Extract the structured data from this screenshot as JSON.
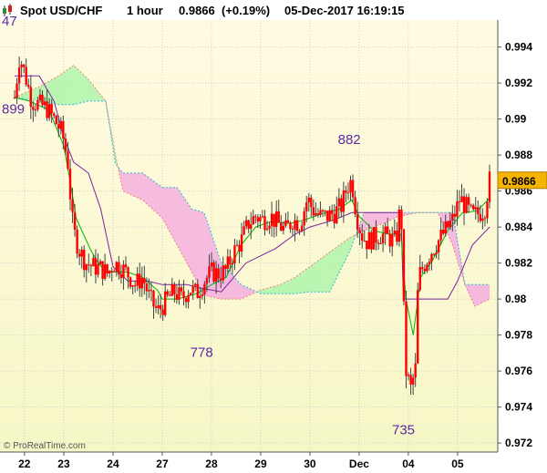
{
  "header": {
    "title": "Spot USD/CHF",
    "timeframe": "1 hour",
    "last_price": "0.9866",
    "change": "(+0.19%)",
    "timestamp": "05-Dec-2017 16:19:15",
    "icon": "candlestick-icon"
  },
  "credit": "© ProRealTime.com",
  "colors": {
    "background_top": "#fffbe2",
    "background_bottom": "#f6f7c6",
    "candle_body": "#ff0000",
    "candle_wick": "#444444",
    "tenkan": "#00b400",
    "kijun": "#7b1fa2",
    "chikou_cloud_bullish": "#b8f5b0",
    "cloud_bearish": "#f6b8de",
    "span_a": "#f08080",
    "span_b": "#2ab7d8",
    "price_tag": "#f4b400",
    "annotation": "#5b2aa0",
    "grid": "#cfcfcf"
  },
  "chart_data": {
    "type": "candlestick",
    "instrument": "Spot USD/CHF",
    "interval": "1 hour",
    "ylim": [
      0.9715,
      0.9955
    ],
    "y_ticks": [
      "0.972",
      "0.974",
      "0.976",
      "0.978",
      "0.98",
      "0.982",
      "0.984",
      "0.986",
      "0.988",
      "0.99",
      "0.992",
      "0.994"
    ],
    "y_tick_values": [
      0.972,
      0.974,
      0.976,
      0.978,
      0.98,
      0.982,
      0.984,
      0.986,
      0.988,
      0.99,
      0.992,
      0.994
    ],
    "x_ticks": [
      "22",
      "23",
      "24",
      "27",
      "28",
      "29",
      "30",
      "Dec",
      "04",
      "05"
    ],
    "x_tick_sessions": [
      0.2,
      1.0,
      2.0,
      3.0,
      4.0,
      5.0,
      6.0,
      7.0,
      8.0,
      9.0
    ],
    "sessions_span": [
      0,
      9.65
    ],
    "current_price": "0.9866",
    "annotations": [
      {
        "text": "47",
        "x": 0.0,
        "y": 0.9948
      },
      {
        "text": "899",
        "x": 0.0,
        "y": 0.9899
      },
      {
        "text": "882",
        "x": 6.8,
        "y": 0.9882
      },
      {
        "text": "778",
        "x": 3.8,
        "y": 0.9778
      },
      {
        "text": "735",
        "x": 7.9,
        "y": 0.9735
      }
    ],
    "close_path": [
      [
        0.0,
        0.9912
      ],
      [
        0.1,
        0.9935
      ],
      [
        0.2,
        0.9926
      ],
      [
        0.35,
        0.991
      ],
      [
        0.5,
        0.9908
      ],
      [
        0.65,
        0.9906
      ],
      [
        0.8,
        0.99
      ],
      [
        0.95,
        0.9893
      ],
      [
        1.0,
        0.9888
      ],
      [
        1.1,
        0.9873
      ],
      [
        1.15,
        0.9848
      ],
      [
        1.2,
        0.9838
      ],
      [
        1.3,
        0.9828
      ],
      [
        1.45,
        0.982
      ],
      [
        1.6,
        0.9818
      ],
      [
        1.75,
        0.9817
      ],
      [
        1.9,
        0.9814
      ],
      [
        2.0,
        0.982
      ],
      [
        2.15,
        0.9818
      ],
      [
        2.3,
        0.9814
      ],
      [
        2.45,
        0.9808
      ],
      [
        2.6,
        0.9812
      ],
      [
        2.75,
        0.98
      ],
      [
        2.9,
        0.9793
      ],
      [
        3.0,
        0.9796
      ],
      [
        3.1,
        0.98
      ],
      [
        3.25,
        0.9804
      ],
      [
        3.4,
        0.98
      ],
      [
        3.55,
        0.9806
      ],
      [
        3.7,
        0.9803
      ],
      [
        3.85,
        0.981
      ],
      [
        4.0,
        0.9815
      ],
      [
        4.15,
        0.9814
      ],
      [
        4.3,
        0.9816
      ],
      [
        4.45,
        0.9826
      ],
      [
        4.6,
        0.9832
      ],
      [
        4.75,
        0.9842
      ],
      [
        4.9,
        0.9846
      ],
      [
        5.05,
        0.9844
      ],
      [
        5.2,
        0.9846
      ],
      [
        5.35,
        0.9842
      ],
      [
        5.5,
        0.9838
      ],
      [
        5.65,
        0.9844
      ],
      [
        5.8,
        0.9842
      ],
      [
        5.95,
        0.9856
      ],
      [
        6.05,
        0.985
      ],
      [
        6.2,
        0.9846
      ],
      [
        6.35,
        0.9846
      ],
      [
        6.5,
        0.9848
      ],
      [
        6.65,
        0.9852
      ],
      [
        6.75,
        0.9862
      ],
      [
        6.85,
        0.9866
      ],
      [
        6.95,
        0.9846
      ],
      [
        7.05,
        0.9836
      ],
      [
        7.15,
        0.9832
      ],
      [
        7.3,
        0.9834
      ],
      [
        7.45,
        0.9836
      ],
      [
        7.6,
        0.9834
      ],
      [
        7.75,
        0.9832
      ],
      [
        7.85,
        0.9854
      ],
      [
        7.9,
        0.98
      ],
      [
        7.95,
        0.976
      ],
      [
        8.05,
        0.975
      ],
      [
        8.15,
        0.9762
      ],
      [
        8.2,
        0.9812
      ],
      [
        8.3,
        0.9818
      ],
      [
        8.45,
        0.9826
      ],
      [
        8.6,
        0.9832
      ],
      [
        8.75,
        0.9838
      ],
      [
        8.9,
        0.9844
      ],
      [
        9.05,
        0.9856
      ],
      [
        9.15,
        0.9852
      ],
      [
        9.3,
        0.9846
      ],
      [
        9.45,
        0.9848
      ],
      [
        9.55,
        0.985
      ],
      [
        9.65,
        0.9866
      ]
    ],
    "tenkan": [
      [
        0.0,
        0.9912
      ],
      [
        0.3,
        0.991
      ],
      [
        0.7,
        0.9905
      ],
      [
        1.0,
        0.9885
      ],
      [
        1.15,
        0.9862
      ],
      [
        1.25,
        0.9845
      ],
      [
        1.4,
        0.9836
      ],
      [
        1.55,
        0.9827
      ],
      [
        1.7,
        0.982
      ],
      [
        1.85,
        0.9815
      ],
      [
        2.0,
        0.9815
      ],
      [
        2.3,
        0.9815
      ],
      [
        2.6,
        0.9812
      ],
      [
        2.9,
        0.9805
      ],
      [
        3.0,
        0.98
      ],
      [
        3.3,
        0.98
      ],
      [
        3.7,
        0.9803
      ],
      [
        4.0,
        0.9808
      ],
      [
        4.3,
        0.9812
      ],
      [
        4.6,
        0.983
      ],
      [
        4.9,
        0.984
      ],
      [
        5.2,
        0.9843
      ],
      [
        5.6,
        0.9842
      ],
      [
        5.9,
        0.9844
      ],
      [
        6.2,
        0.9847
      ],
      [
        6.6,
        0.985
      ],
      [
        6.85,
        0.9855
      ],
      [
        7.0,
        0.9846
      ],
      [
        7.3,
        0.9838
      ],
      [
        7.6,
        0.9836
      ],
      [
        7.85,
        0.9836
      ],
      [
        7.95,
        0.98
      ],
      [
        8.1,
        0.978
      ],
      [
        8.25,
        0.9812
      ],
      [
        8.5,
        0.9822
      ],
      [
        8.8,
        0.9838
      ],
      [
        9.1,
        0.9848
      ],
      [
        9.4,
        0.9849
      ],
      [
        9.65,
        0.9856
      ]
    ],
    "kijun": [
      [
        0.0,
        0.9924
      ],
      [
        0.5,
        0.9924
      ],
      [
        0.8,
        0.991
      ],
      [
        1.0,
        0.989
      ],
      [
        1.2,
        0.9876
      ],
      [
        1.5,
        0.987
      ],
      [
        1.75,
        0.985
      ],
      [
        2.0,
        0.9818
      ],
      [
        2.3,
        0.981
      ],
      [
        2.7,
        0.981
      ],
      [
        3.0,
        0.9808
      ],
      [
        3.5,
        0.9808
      ],
      [
        3.8,
        0.9806
      ],
      [
        4.2,
        0.9804
      ],
      [
        4.45,
        0.9812
      ],
      [
        4.7,
        0.982
      ],
      [
        5.0,
        0.9824
      ],
      [
        5.3,
        0.9828
      ],
      [
        5.7,
        0.9836
      ],
      [
        6.0,
        0.984
      ],
      [
        6.5,
        0.9844
      ],
      [
        6.85,
        0.9848
      ],
      [
        7.2,
        0.9848
      ],
      [
        7.6,
        0.9848
      ],
      [
        7.85,
        0.9848
      ],
      [
        7.9,
        0.98
      ],
      [
        8.3,
        0.98
      ],
      [
        8.8,
        0.98
      ],
      [
        9.0,
        0.981
      ],
      [
        9.3,
        0.983
      ],
      [
        9.65,
        0.984
      ]
    ],
    "span_a": [
      [
        0.0,
        0.9912
      ],
      [
        0.5,
        0.9918
      ],
      [
        0.9,
        0.9924
      ],
      [
        1.2,
        0.993
      ],
      [
        1.5,
        0.9922
      ],
      [
        1.85,
        0.991
      ],
      [
        2.05,
        0.988
      ],
      [
        2.2,
        0.986
      ],
      [
        2.6,
        0.9855
      ],
      [
        3.0,
        0.9845
      ],
      [
        3.3,
        0.983
      ],
      [
        3.6,
        0.9815
      ],
      [
        3.85,
        0.9802
      ],
      [
        4.2,
        0.98
      ],
      [
        4.6,
        0.98
      ],
      [
        5.0,
        0.9805
      ],
      [
        5.4,
        0.9808
      ],
      [
        5.7,
        0.9812
      ],
      [
        6.0,
        0.9818
      ],
      [
        6.4,
        0.9826
      ],
      [
        6.8,
        0.9834
      ],
      [
        7.1,
        0.9838
      ],
      [
        7.5,
        0.9842
      ],
      [
        7.8,
        0.9846
      ],
      [
        8.2,
        0.9848
      ],
      [
        8.6,
        0.9848
      ],
      [
        8.9,
        0.983
      ],
      [
        9.15,
        0.9808
      ],
      [
        9.35,
        0.9796
      ],
      [
        9.65,
        0.98
      ]
    ],
    "span_b": [
      [
        0.0,
        0.9912
      ],
      [
        0.5,
        0.991
      ],
      [
        0.9,
        0.9908
      ],
      [
        1.2,
        0.9908
      ],
      [
        1.5,
        0.991
      ],
      [
        1.85,
        0.991
      ],
      [
        2.05,
        0.9875
      ],
      [
        2.2,
        0.987
      ],
      [
        2.6,
        0.987
      ],
      [
        3.0,
        0.9862
      ],
      [
        3.3,
        0.9862
      ],
      [
        3.6,
        0.985
      ],
      [
        3.85,
        0.9848
      ],
      [
        4.2,
        0.982
      ],
      [
        4.6,
        0.9808
      ],
      [
        5.0,
        0.9803
      ],
      [
        5.4,
        0.9803
      ],
      [
        5.7,
        0.9803
      ],
      [
        6.0,
        0.9804
      ],
      [
        6.4,
        0.9804
      ],
      [
        6.8,
        0.9826
      ],
      [
        7.1,
        0.9848
      ],
      [
        7.5,
        0.9848
      ],
      [
        7.8,
        0.9848
      ],
      [
        8.2,
        0.9848
      ],
      [
        8.6,
        0.9848
      ],
      [
        8.9,
        0.9848
      ],
      [
        9.15,
        0.9808
      ],
      [
        9.35,
        0.9808
      ],
      [
        9.65,
        0.9808
      ]
    ]
  }
}
